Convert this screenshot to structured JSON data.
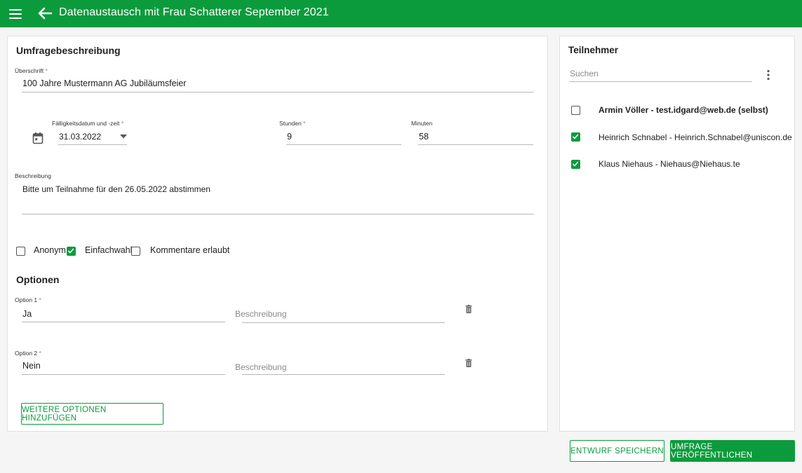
{
  "appbar": {
    "title": "Datenaustausch mit Frau Schatterer September 2021"
  },
  "survey": {
    "section_title": "Umfragebeschreibung",
    "heading_label": "Überschrift",
    "heading_value": "100 Jahre Mustermann AG Jubiläumsfeier",
    "due_label": "Fälligkeitsdatum und -zeit",
    "due_value": "31.03.2022",
    "hours_label": "Stunden",
    "hours_value": "9",
    "minutes_label": "Minuten",
    "minutes_value": "58",
    "description_label": "Beschreibung",
    "description_value": "Bitte um Teilnahme für den 26.05.2022 abstimmen",
    "required_mark": "*",
    "checkboxes": [
      {
        "label": "Anonym",
        "checked": false
      },
      {
        "label": "Einfachwahl",
        "checked": true
      },
      {
        "label": "Kommentare erlaubt",
        "checked": false
      }
    ]
  },
  "options": {
    "section_title": "Optionen",
    "items": [
      {
        "label": "Option 1",
        "value": "Ja",
        "description_placeholder": "Beschreibung"
      },
      {
        "label": "Option 2",
        "value": "Nein",
        "description_placeholder": "Beschreibung"
      }
    ],
    "add_button": "WEITERE OPTIONEN HINZUFÜGEN"
  },
  "participants": {
    "title": "Teilnehmer",
    "search_placeholder": "Suchen",
    "items": [
      {
        "label": "Armin Völler - test.idgard@web.de (selbst)",
        "checked": false,
        "bold": true
      },
      {
        "label": "Heinrich Schnabel - Heinrich.Schnabel@uniscon.de",
        "checked": true,
        "bold": false
      },
      {
        "label": "Klaus Niehaus - Niehaus@Niehaus.te",
        "checked": true,
        "bold": false
      }
    ]
  },
  "footer": {
    "save_draft": "ENTWURF SPEICHERN",
    "publish": "UMFRAGE VERÖFFENTLICHEN"
  },
  "colors": {
    "primary": "#0c9b3c"
  }
}
